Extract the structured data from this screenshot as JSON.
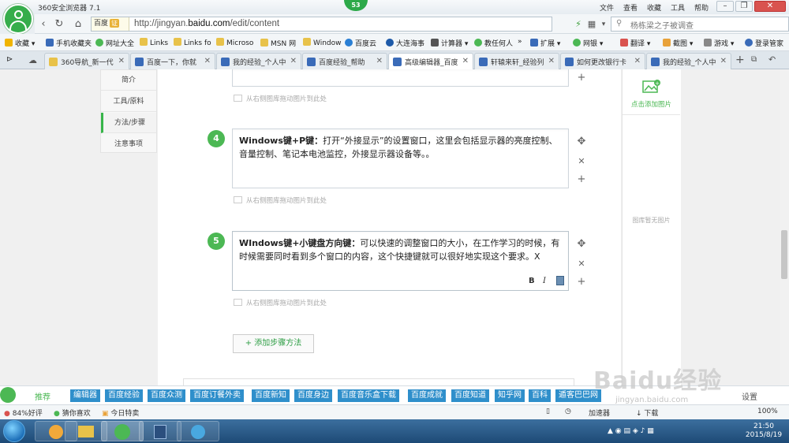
{
  "browser": {
    "title": "360安全浏览器 7.1",
    "badge_count": "53",
    "menu": [
      "文件",
      "查看",
      "收藏",
      "工具",
      "帮助"
    ],
    "address": {
      "engine": "百度",
      "cert": "证",
      "url_prefix": "http://jingyan.",
      "url_domain": "baidu.com",
      "url_path": "/edit/content"
    },
    "search": {
      "value": "杨栋梁之子被调查"
    },
    "bookmarks": [
      "收藏",
      "手机收藏夹",
      "网址大全",
      "Links",
      "Links fo",
      "Microso",
      "MSN 网",
      "Window",
      "百度云",
      "大连海事",
      "计算器",
      "教任何人",
      "扩展",
      "网银",
      "翻译",
      "截图",
      "游戏",
      "登录管家"
    ],
    "tabs": [
      {
        "label": "360导航_新一代"
      },
      {
        "label": "百度一下，你就"
      },
      {
        "label": "我的经验_个人中"
      },
      {
        "label": "百度经验_帮助"
      },
      {
        "label": "高级编辑器_百度"
      },
      {
        "label": "轩辕来轩_经验列"
      },
      {
        "label": "如何更改银行卡"
      },
      {
        "label": "我的经验_个人中"
      }
    ]
  },
  "leftnav": [
    "简介",
    "工具/原料",
    "方法/步骤",
    "注意事项"
  ],
  "steps": [
    {
      "num": "4",
      "bold": "Windows键+P键：",
      "text": "打开“外接显示”的设置窗口，这里会包括显示器的亮度控制、音量控制、笔记本电池监控，外接显示器设备等。。"
    },
    {
      "num": "5",
      "bold": "WIndows键+小键盘方向键：",
      "text": "可以快速的调整窗口的大小，在工作学习的时候，有时候需要同时看到多个窗口的内容，这个快捷键就可以很好地实现这个要求。X"
    }
  ],
  "drag_hint": "从右侧图库拖动图片到此处",
  "format_tools": [
    "B",
    "I"
  ],
  "add_step_label": "+ 添加步骤方法",
  "right_panel": {
    "add_picture": "点击添加图片",
    "empty": "图库暂无图片"
  },
  "bottom_links": [
    "推荐",
    "编辑器",
    "百度经验",
    "百度众测",
    "百度订餐外卖",
    "百度新知",
    "百度身边",
    "百度音乐盒下载",
    "百度成就",
    "百度知道",
    "知乎网",
    "百科",
    "遁客巴巴网"
  ],
  "bottom_settings": "设置",
  "status": {
    "rating": "84%好评",
    "guess": "猜你喜欢",
    "today": "今日特卖",
    "accelerator": "加速器",
    "download": "下载",
    "zoom": "100%"
  },
  "clock": {
    "time": "21:50",
    "date": "2015/8/19"
  },
  "watermark": "Baidu经验",
  "watermark_sub": "jingyan.baidu.com",
  "colors": {
    "accent_green": "#4cb854",
    "link_blue": "#2f8fcb",
    "taskbar": "#1d4a76"
  }
}
